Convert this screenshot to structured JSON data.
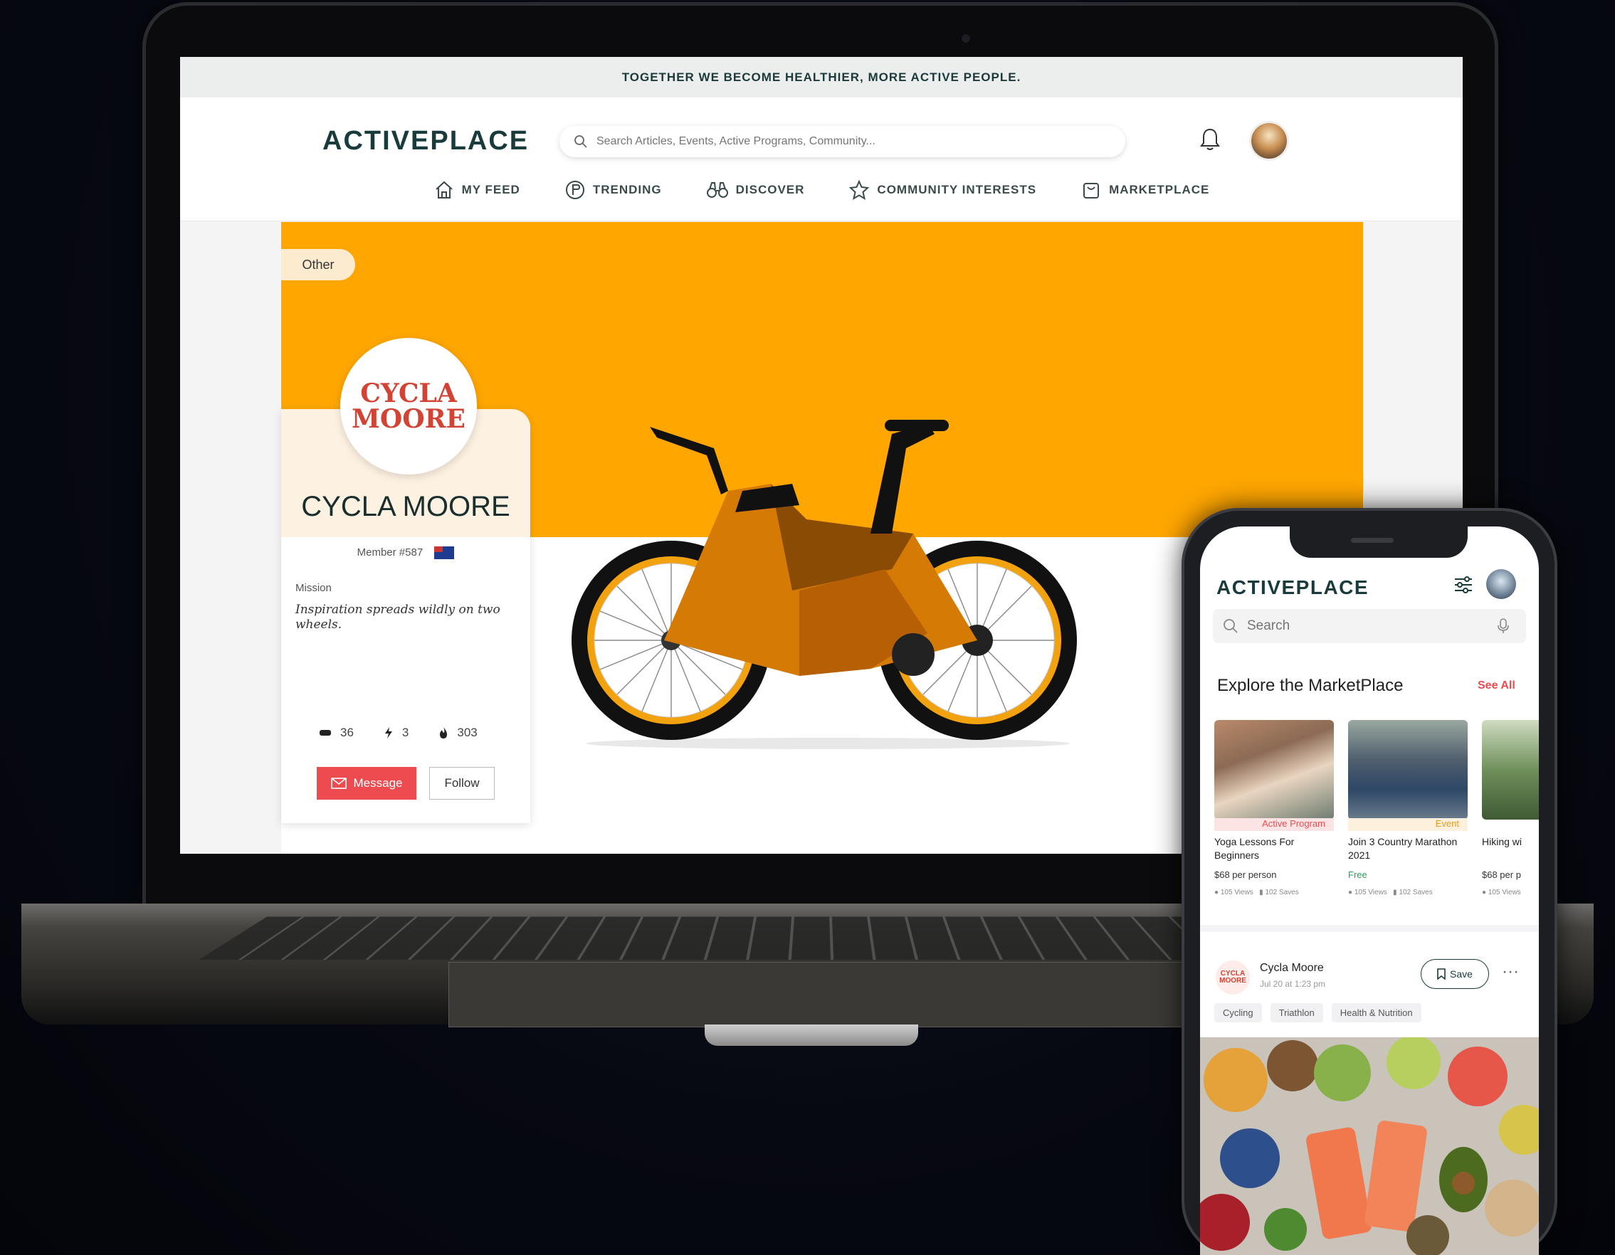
{
  "desktop": {
    "banner": "TOGETHER WE BECOME HEALTHIER, MORE ACTIVE PEOPLE.",
    "logo": "ACTIVEPLACE",
    "search_placeholder": "Search Articles, Events, Active Programs, Community...",
    "nav": [
      {
        "label": "MY FEED",
        "icon": "home-icon"
      },
      {
        "label": "TRENDING",
        "icon": "trending-icon"
      },
      {
        "label": "DISCOVER",
        "icon": "binoculars-icon"
      },
      {
        "label": "COMMUNITY INTERESTS",
        "icon": "star-icon"
      },
      {
        "label": "MARKETPLACE",
        "icon": "bag-icon"
      }
    ],
    "cover_tag": "Other",
    "profile": {
      "logo_line1": "CYCLA",
      "logo_line2": "MOORE",
      "name": "CYCLA MOORE",
      "member": "Member #587",
      "mission_label": "Mission",
      "mission": "Inspiration spreads wildly on two wheels.",
      "stats": [
        {
          "icon": "followers-icon",
          "value": "36"
        },
        {
          "icon": "bolt-icon",
          "value": "3"
        },
        {
          "icon": "fire-icon",
          "value": "303"
        }
      ],
      "message_label": "Message",
      "follow_label": "Follow"
    },
    "colors": {
      "cover": "#ffa600",
      "accent": "#ee4b50",
      "brand": "#1a3b3b"
    }
  },
  "mobile": {
    "logo": "ACTIVEPLACE",
    "search_placeholder": "Search",
    "section_title": "Explore the MarketPlace",
    "see_all": "See All",
    "cards": [
      {
        "tag": "Active Program",
        "title": "Yoga Lessons For Beginners",
        "price": "$68 per person",
        "views": "105 Views",
        "saves": "102 Saves"
      },
      {
        "tag": "Event",
        "title": "Join 3 Country Marathon 2021",
        "price": "Free",
        "views": "105 Views",
        "saves": "102 Saves"
      },
      {
        "tag": "",
        "title": "Hiking wi",
        "price": "$68 per p",
        "views": "105 Views",
        "saves": ""
      }
    ],
    "post": {
      "author": "Cycla Moore",
      "time": "Jul 20 at 1:23 pm",
      "save_label": "Save",
      "tags": [
        "Cycling",
        "Triathlon",
        "Health & Nutrition"
      ]
    }
  }
}
